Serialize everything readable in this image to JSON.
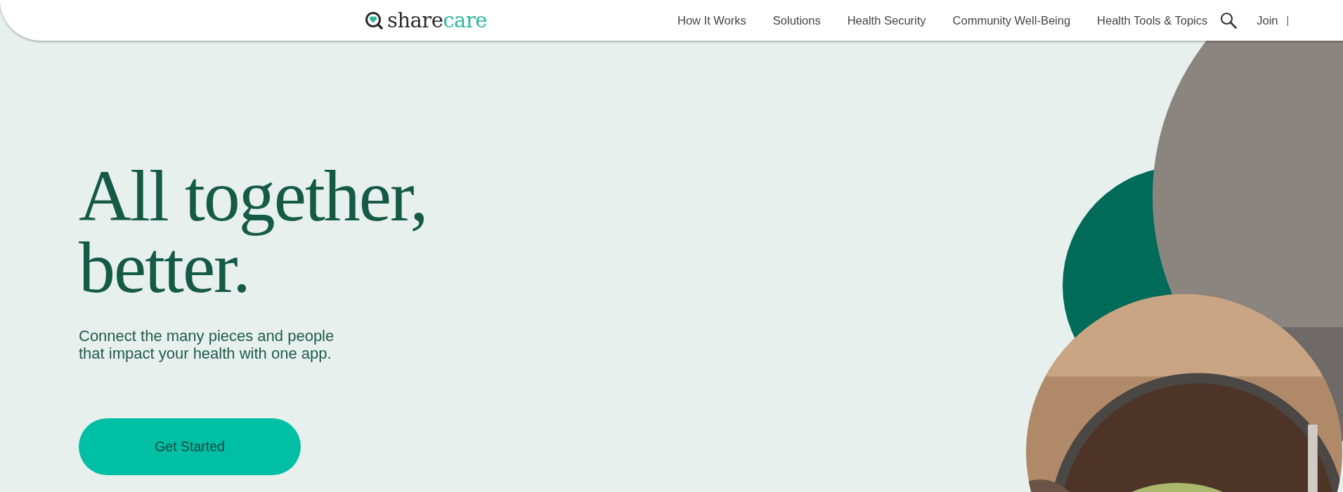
{
  "header": {
    "logo": {
      "dark_part": "share",
      "accent_part": "care"
    },
    "nav": [
      {
        "label": "How It Works"
      },
      {
        "label": "Solutions"
      },
      {
        "label": "Health Security"
      },
      {
        "label": "Community Well-Being"
      },
      {
        "label": "Health Tools & Topics"
      }
    ],
    "join": "Join",
    "separator": "|"
  },
  "hero": {
    "headline": [
      "All together,",
      "better."
    ],
    "subtitle": [
      "Connect the many pieces and people",
      "that impact your health with one app."
    ],
    "button": "Get Started"
  }
}
